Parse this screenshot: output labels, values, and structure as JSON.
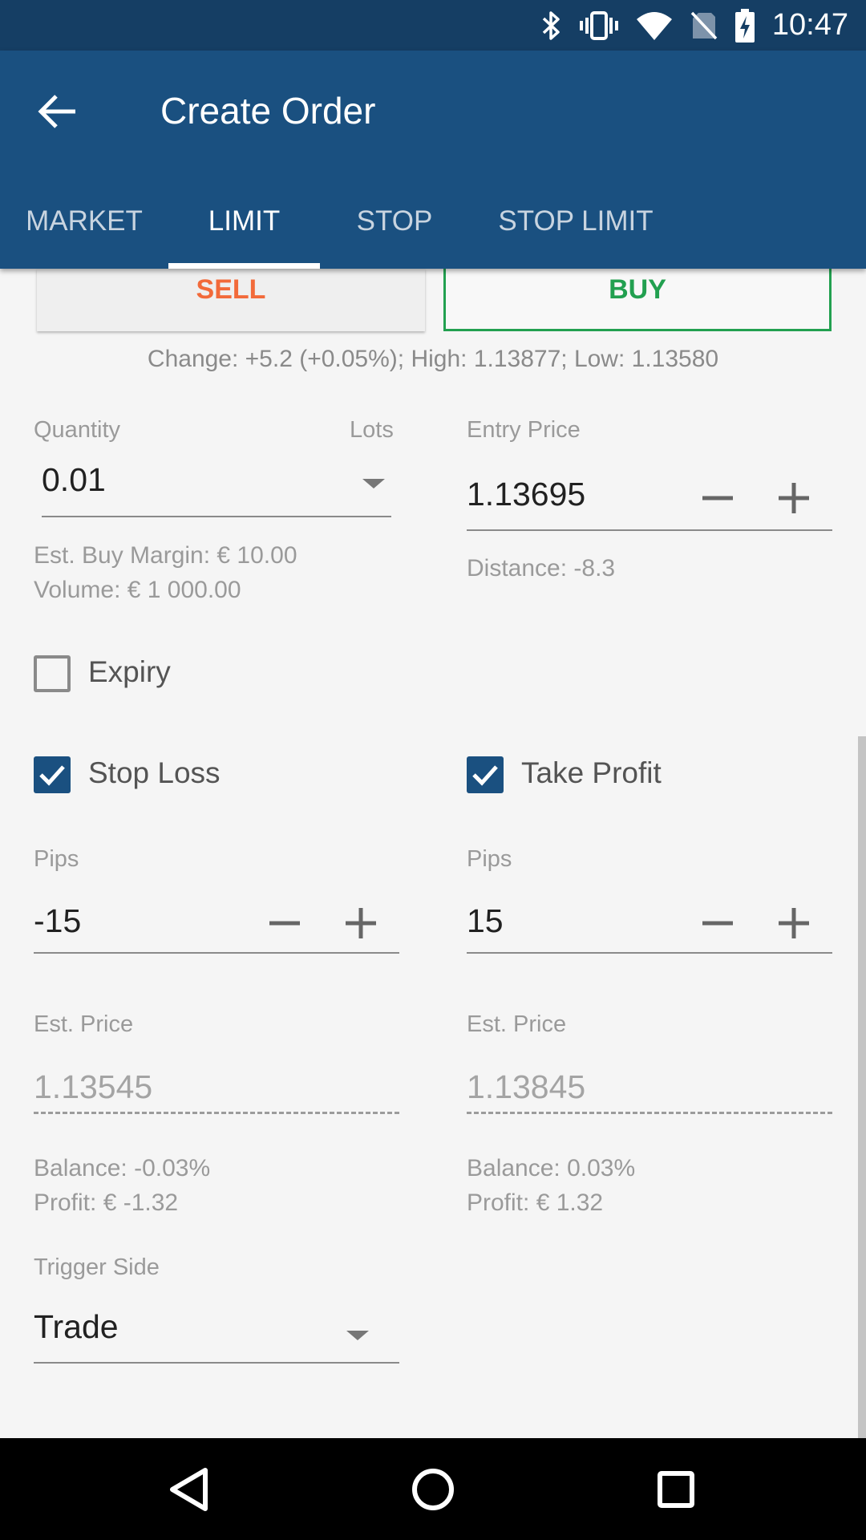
{
  "status_bar": {
    "time": "10:47",
    "icons": [
      "bluetooth-icon",
      "vibrate-icon",
      "wifi-icon",
      "no-sim-icon",
      "battery-charging-icon"
    ]
  },
  "app_bar": {
    "title": "Create Order",
    "back_icon": "arrow-left-icon"
  },
  "tabs": [
    {
      "label": "MARKET",
      "active": false
    },
    {
      "label": "LIMIT",
      "active": true
    },
    {
      "label": "STOP",
      "active": false
    },
    {
      "label": "STOP LIMIT",
      "active": false
    }
  ],
  "order_side": {
    "sell_label": "SELL",
    "buy_label": "BUY",
    "selected": "BUY"
  },
  "market_info": "Change: +5.2 (+0.05%); High: 1.13877; Low: 1.13580",
  "quantity": {
    "label": "Quantity",
    "unit": "Lots",
    "value": "0.01",
    "margin": "Est. Buy Margin: € 10.00",
    "volume": "Volume: € 1 000.00"
  },
  "entry_price": {
    "label": "Entry Price",
    "value": "1.13695",
    "distance": "Distance: -8.3"
  },
  "expiry": {
    "label": "Expiry",
    "checked": false
  },
  "stop_loss": {
    "label": "Stop Loss",
    "checked": true,
    "pips_label": "Pips",
    "pips_value": "-15",
    "est_price_label": "Est. Price",
    "est_price_value": "1.13545",
    "balance": "Balance: -0.03%",
    "profit": "Profit: € -1.32"
  },
  "take_profit": {
    "label": "Take Profit",
    "checked": true,
    "pips_label": "Pips",
    "pips_value": "15",
    "est_price_label": "Est. Price",
    "est_price_value": "1.13845",
    "balance": "Balance: 0.03%",
    "profit": "Profit: € 1.32"
  },
  "trigger_side": {
    "label": "Trigger Side",
    "value": "Trade"
  },
  "colors": {
    "primary": "#1a5080",
    "status_bar": "#153e64",
    "sell": "#f26a3a",
    "buy": "#22a050"
  },
  "nav_bar": {
    "icons": [
      "back-triangle-icon",
      "home-circle-icon",
      "recents-square-icon"
    ]
  }
}
